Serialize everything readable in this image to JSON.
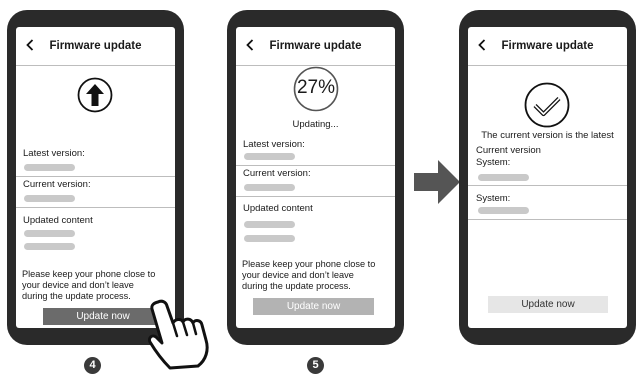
{
  "header": {
    "back_icon": "chevron-left-icon",
    "title": "Firmware update"
  },
  "screen4": {
    "icon": "upload-arrow-icon",
    "latest_label": "Latest version:",
    "current_label": "Current version:",
    "updated_label": "Updated content",
    "note": [
      "Please keep your phone close to",
      "your device and don’t leave",
      "during the update process."
    ],
    "button_label": "Update now",
    "step": "4"
  },
  "screen5": {
    "progress_text": "27%",
    "progress": 0.27,
    "status_text": "Updating...",
    "latest_label": "Latest version:",
    "current_label": "Current version:",
    "updated_label": "Updated content",
    "note": [
      "Please keep your phone close to",
      "your device and don’t leave",
      "during the update process."
    ],
    "button_label": "Update now",
    "step": "5"
  },
  "screen6": {
    "icon": "checkmark-icon",
    "status_text": "The current version is the latest",
    "current_label": "Current version",
    "system_label_1": "System:",
    "system_label_2": "System:",
    "button_label": "Update now"
  },
  "decor": {
    "pointer_icon": "hand-pointer-icon",
    "arrow_icon": "right-arrow-icon"
  },
  "colors": {
    "phone_body": "#2a2a2a",
    "button_active": "#6b6b6b",
    "button_disabled": "#b3b3b3",
    "button_light": "#e6e6e6",
    "placeholder_bar": "#c9c9c9"
  }
}
